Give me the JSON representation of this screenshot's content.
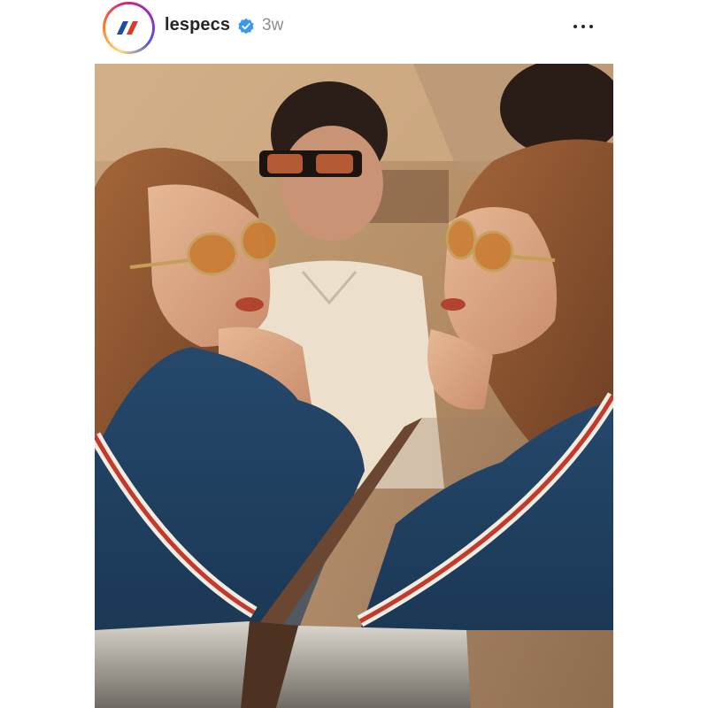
{
  "post": {
    "username": "lespecs",
    "verified": true,
    "timestamp": "3w",
    "avatar": {
      "icon": "le-specs-logo-icon",
      "stripe_colors": [
        "#1d4fa0",
        "#d93a2b"
      ]
    },
    "more_icon": "more-horizontal-icon",
    "photo": {
      "description_icon": "fashion-photo-image"
    }
  },
  "colors": {
    "text_primary": "#262626",
    "text_secondary": "#8e8e8e",
    "verified_blue": "#3897f0"
  }
}
